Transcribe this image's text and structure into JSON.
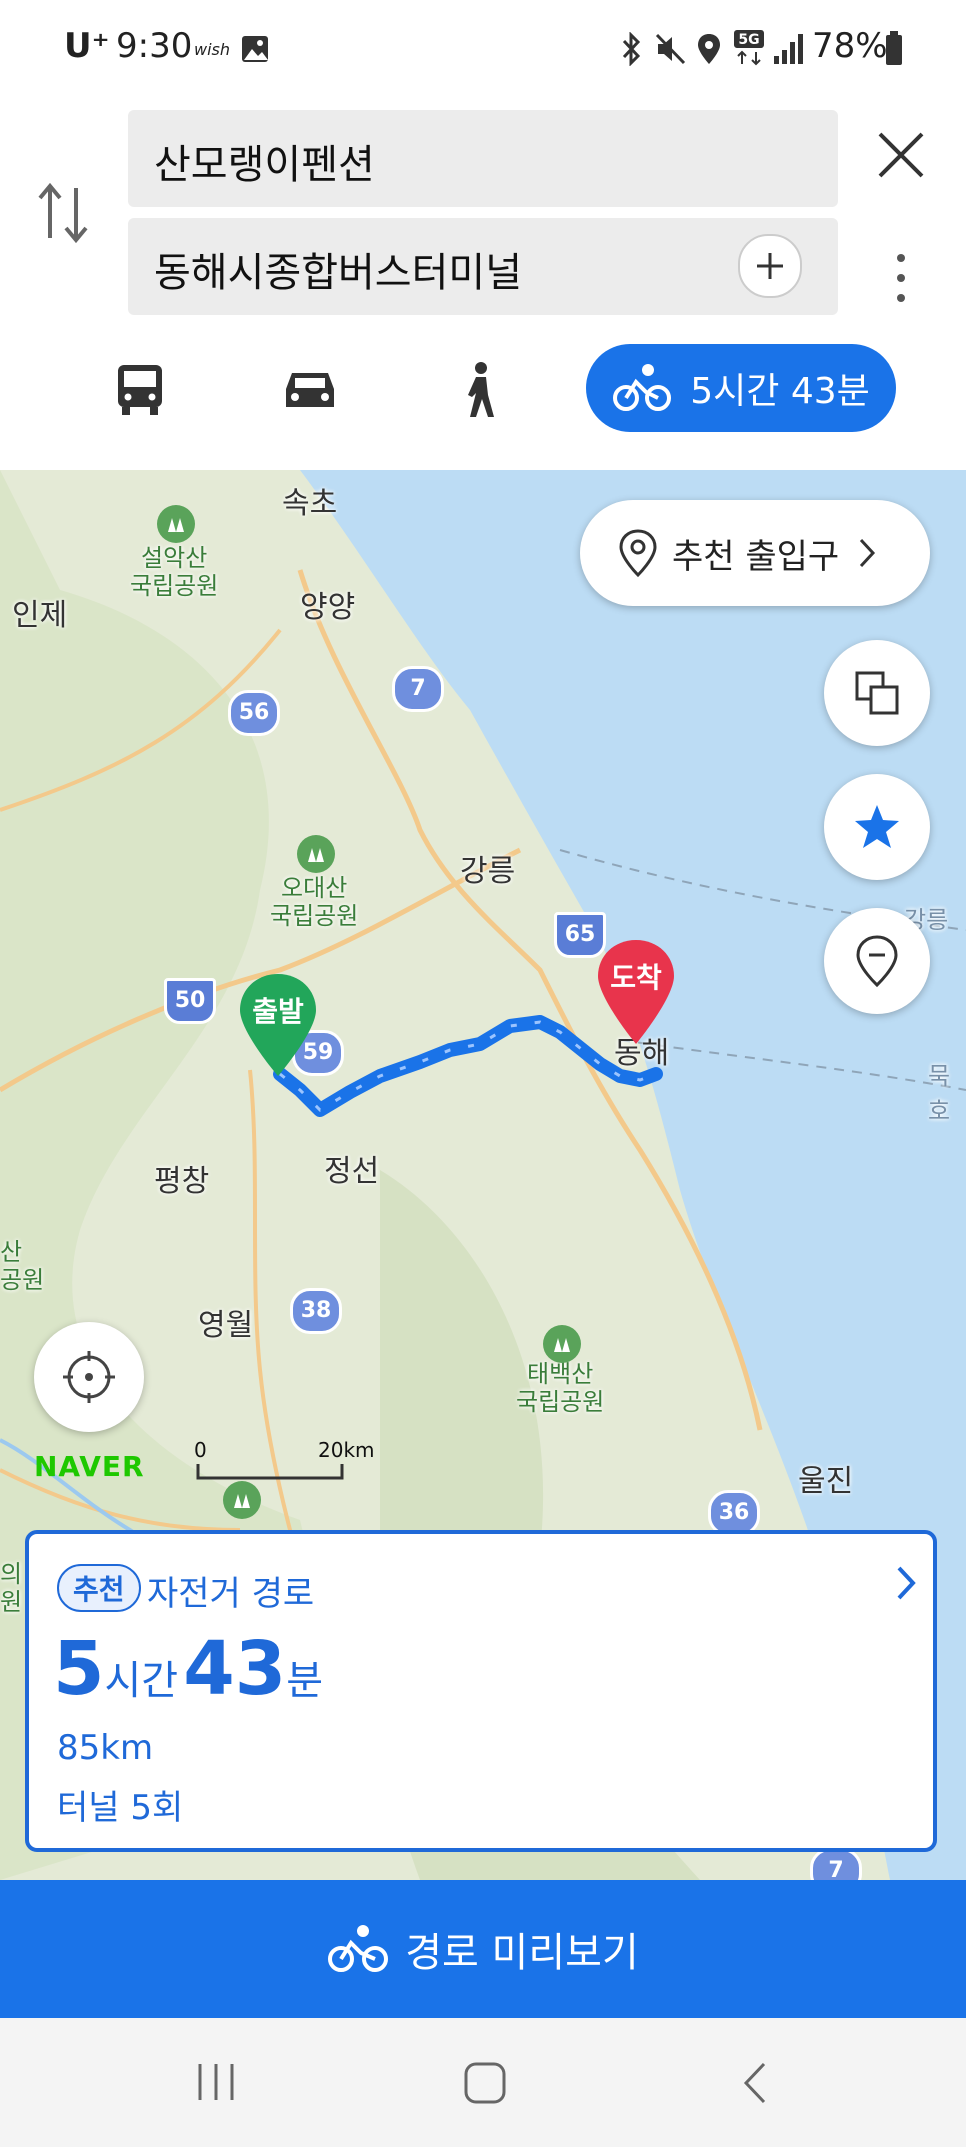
{
  "status_bar": {
    "carrier": "U⁺",
    "time": "9:30",
    "wish": "wish",
    "battery": "78%"
  },
  "route": {
    "origin": "산모랭이펜션",
    "destination": "동해시종합버스터미널"
  },
  "modes": {
    "bike_duration": "5시간 43분"
  },
  "map": {
    "recommend_entrance": "추천 출입구",
    "start_marker": "출발",
    "end_marker": "도착",
    "brand": "NAVER",
    "scale_zero": "0",
    "scale_max": "20km",
    "labels": {
      "sokcho": "속초",
      "inje": "인제",
      "seorak": "설악산\n국립공원",
      "yangyang": "양양",
      "gangneung": "강릉",
      "odae": "오대산\n국립공원",
      "donghae": "동해",
      "pyeongchang": "평창",
      "jeongseon": "정선",
      "yeongwol": "영월",
      "taebaek": "태백산\n국립공원",
      "uljin": "울진",
      "gangneung_port": "강릉항",
      "mukho": "묵호",
      "left_park": "산\n공원",
      "left_park2": "의\n원"
    },
    "shields": {
      "r56": "56",
      "r7": "7",
      "r65": "65",
      "r50": "50",
      "r59": "59",
      "r38": "38",
      "r36": "36",
      "r7b": "7"
    }
  },
  "result_card": {
    "badge": "추천",
    "type": "자전거 경로",
    "hours": "5",
    "hours_unit": "시간",
    "minutes": "43",
    "minutes_unit": "분",
    "distance": "85km",
    "tunnels": "터널 5회"
  },
  "cta": {
    "label": "경로 미리보기"
  },
  "colors": {
    "accent": "#1a73e8",
    "start": "#22a65a",
    "end": "#e8344c",
    "water": "#bcdcf4",
    "route": "#1a73e8"
  }
}
